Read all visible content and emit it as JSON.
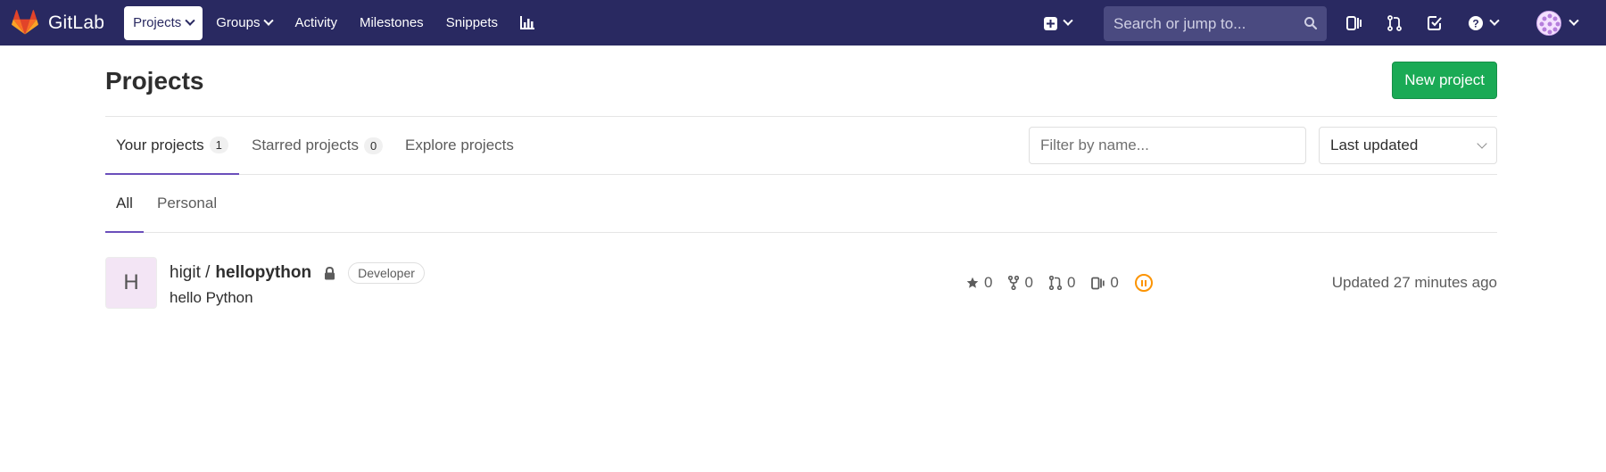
{
  "brand": {
    "name": "GitLab",
    "logo_icon": "gitlab-tanuki-icon"
  },
  "navbar": {
    "items": [
      {
        "label": "Projects",
        "dropdown": true,
        "active": true
      },
      {
        "label": "Groups",
        "dropdown": true,
        "active": false
      },
      {
        "label": "Activity",
        "dropdown": false,
        "active": false
      },
      {
        "label": "Milestones",
        "dropdown": false,
        "active": false
      },
      {
        "label": "Snippets",
        "dropdown": false,
        "active": false
      }
    ],
    "chart_icon": "chart-icon",
    "search": {
      "placeholder": "Search or jump to...",
      "icon": "search-icon"
    },
    "right_icons": [
      "plus-square-icon",
      "issues-icon",
      "merge-request-icon",
      "todo-icon",
      "help-icon",
      "user-avatar"
    ],
    "background_color": "#292961"
  },
  "page": {
    "title": "Projects",
    "new_project_label": "New project",
    "accent_green": "#1aaa55"
  },
  "tabs": [
    {
      "label": "Your projects",
      "count": "1",
      "active": true
    },
    {
      "label": "Starred projects",
      "count": "0",
      "active": false
    },
    {
      "label": "Explore projects",
      "count": "",
      "active": false
    }
  ],
  "filter": {
    "placeholder": "Filter by name..."
  },
  "sort": {
    "selected": "Last updated"
  },
  "subtabs": [
    {
      "label": "All",
      "active": true
    },
    {
      "label": "Personal",
      "active": false
    }
  ],
  "projects": [
    {
      "avatar_letter": "H",
      "namespace": "higit /",
      "name": "hellopython",
      "visibility_icon": "lock-icon",
      "role": "Developer",
      "description": "hello Python",
      "stars": "0",
      "forks": "0",
      "merge_requests": "0",
      "issues": "0",
      "pipeline_status_icon": "pipeline-paused-icon",
      "pipeline_color": "#fc9403",
      "updated": "Updated 27 minutes ago"
    }
  ]
}
